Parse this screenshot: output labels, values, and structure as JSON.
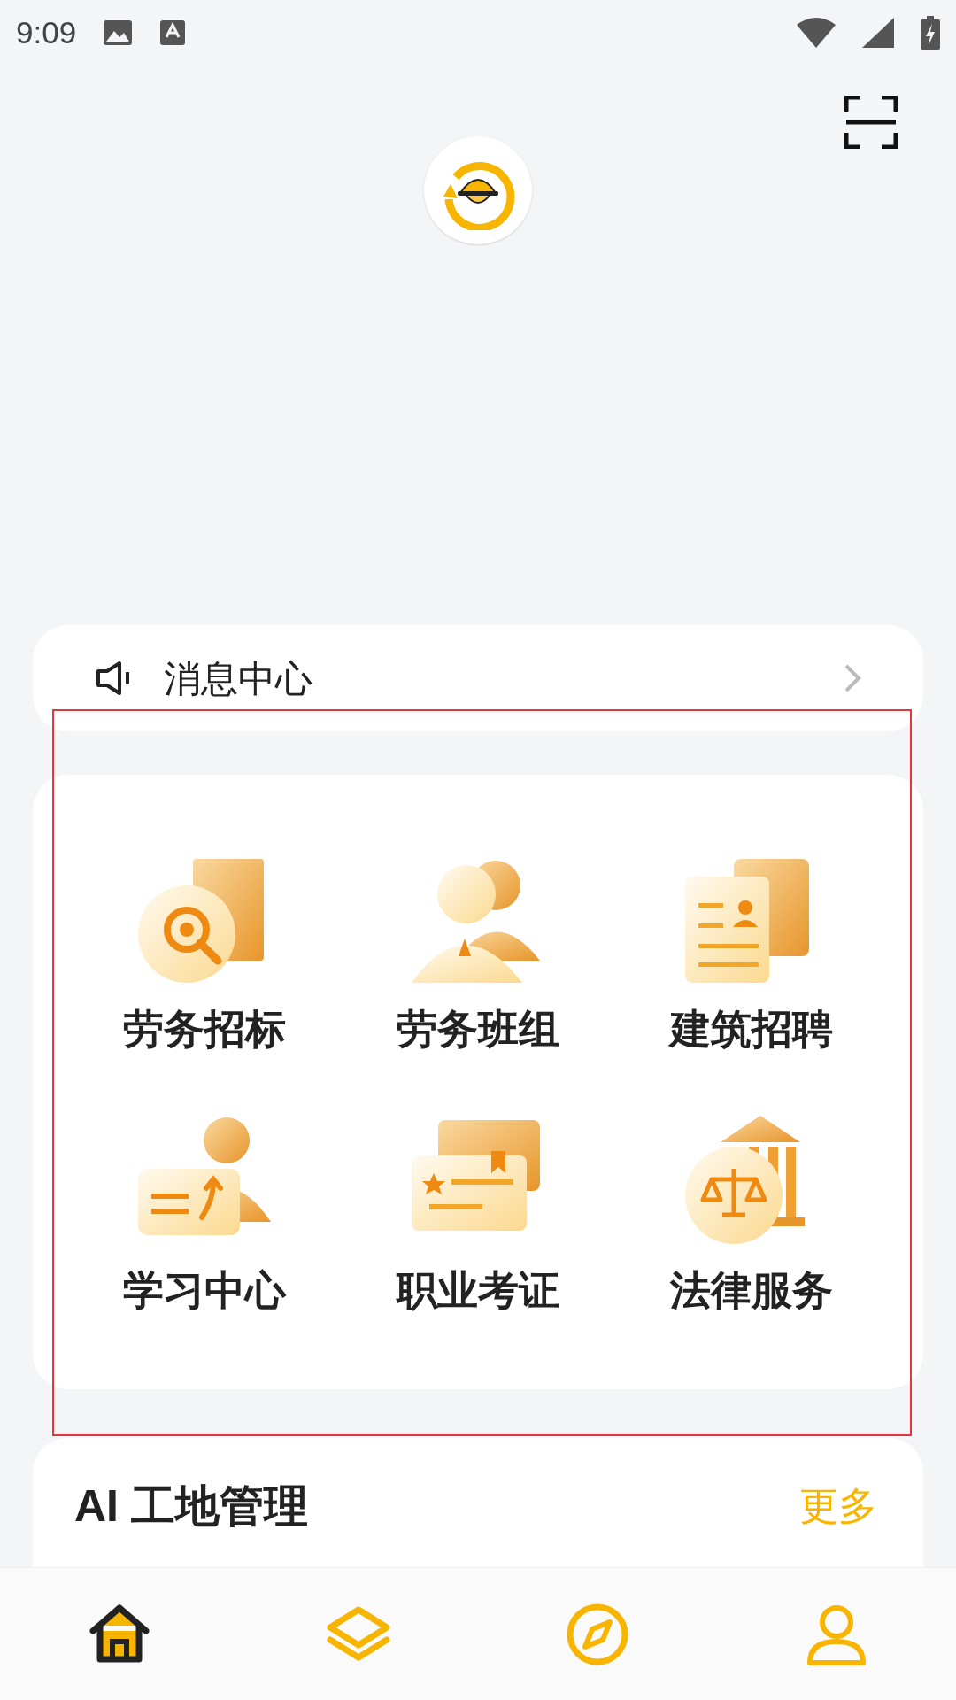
{
  "status_bar": {
    "time": "9:09"
  },
  "notice": {
    "label": "消息中心"
  },
  "services": [
    {
      "label": "劳务招标",
      "kind": "search"
    },
    {
      "label": "劳务班组",
      "kind": "team"
    },
    {
      "label": "建筑招聘",
      "kind": "resume"
    },
    {
      "label": "学习中心",
      "kind": "teach"
    },
    {
      "label": "职业考证",
      "kind": "certificate"
    },
    {
      "label": "法律服务",
      "kind": "law"
    }
  ],
  "ai_section": {
    "title": "AI 工地管理",
    "more": "更多"
  },
  "bottom_nav": [
    {
      "kind": "home",
      "selected": true
    },
    {
      "kind": "layers",
      "selected": false
    },
    {
      "kind": "compass",
      "selected": false
    },
    {
      "kind": "profile",
      "selected": false
    }
  ]
}
